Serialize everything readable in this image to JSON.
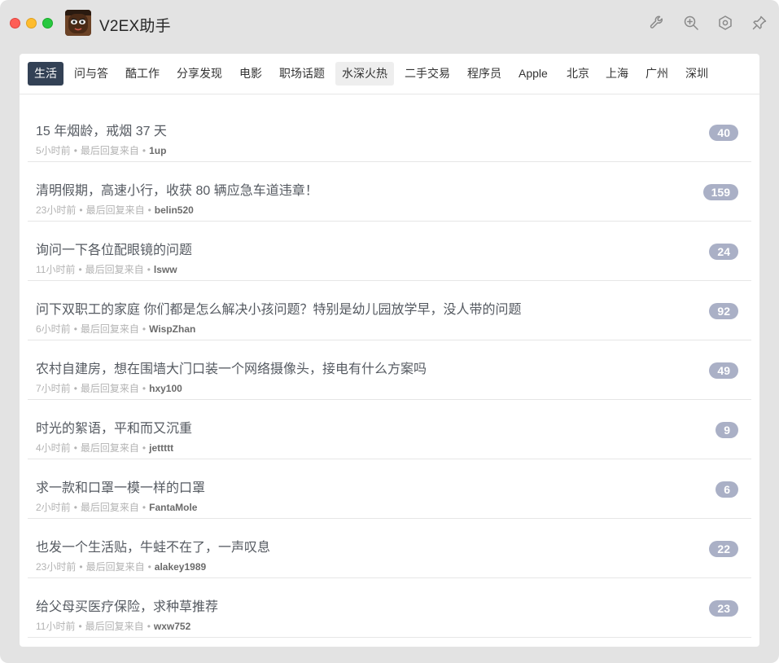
{
  "app": {
    "title": "V2EX助手"
  },
  "toolbar": {
    "icons": [
      "wrench-icon",
      "zoom-in-icon",
      "settings-icon",
      "pin-icon"
    ]
  },
  "tabs": [
    {
      "label": "生活",
      "state": "active"
    },
    {
      "label": "问与答"
    },
    {
      "label": "酷工作"
    },
    {
      "label": "分享发现"
    },
    {
      "label": "电影"
    },
    {
      "label": "职场话题"
    },
    {
      "label": "水深火热",
      "state": "hover"
    },
    {
      "label": "二手交易"
    },
    {
      "label": "程序员"
    },
    {
      "label": "Apple"
    },
    {
      "label": "北京"
    },
    {
      "label": "上海"
    },
    {
      "label": "广州"
    },
    {
      "label": "深圳"
    }
  ],
  "topics": [
    {
      "title": "15 年烟龄，戒烟 37 天",
      "time": "5小时前",
      "reply_label": "最后回复来自",
      "author": "1up",
      "replies": "40"
    },
    {
      "title": "清明假期，高速小行，收获 80 辆应急车道违章！",
      "time": "23小时前",
      "reply_label": "最后回复来自",
      "author": "belin520",
      "replies": "159"
    },
    {
      "title": "询问一下各位配眼镜的问题",
      "time": "11小时前",
      "reply_label": "最后回复来自",
      "author": "lsww",
      "replies": "24"
    },
    {
      "title": "问下双职工的家庭 你们都是怎么解决小孩问题？特别是幼儿园放学早，没人带的问题",
      "time": "6小时前",
      "reply_label": "最后回复来自",
      "author": "WispZhan",
      "replies": "92"
    },
    {
      "title": "农村自建房，想在围墙大门口装一个网络摄像头，接电有什么方案吗",
      "time": "7小时前",
      "reply_label": "最后回复来自",
      "author": "hxy100",
      "replies": "49"
    },
    {
      "title": "时光的絮语，平和而又沉重",
      "time": "4小时前",
      "reply_label": "最后回复来自",
      "author": "jettttt",
      "replies": "9"
    },
    {
      "title": "求一款和口罩一模一样的口罩",
      "time": "2小时前",
      "reply_label": "最后回复来自",
      "author": "FantaMole",
      "replies": "6"
    },
    {
      "title": "也发一个生活贴，牛蛙不在了，一声叹息",
      "time": "23小时前",
      "reply_label": "最后回复来自",
      "author": "alakey1989",
      "replies": "22"
    },
    {
      "title": "给父母买医疗保险，求种草推荐",
      "time": "11小时前",
      "reply_label": "最后回复来自",
      "author": "wxw752",
      "replies": "23"
    }
  ]
}
